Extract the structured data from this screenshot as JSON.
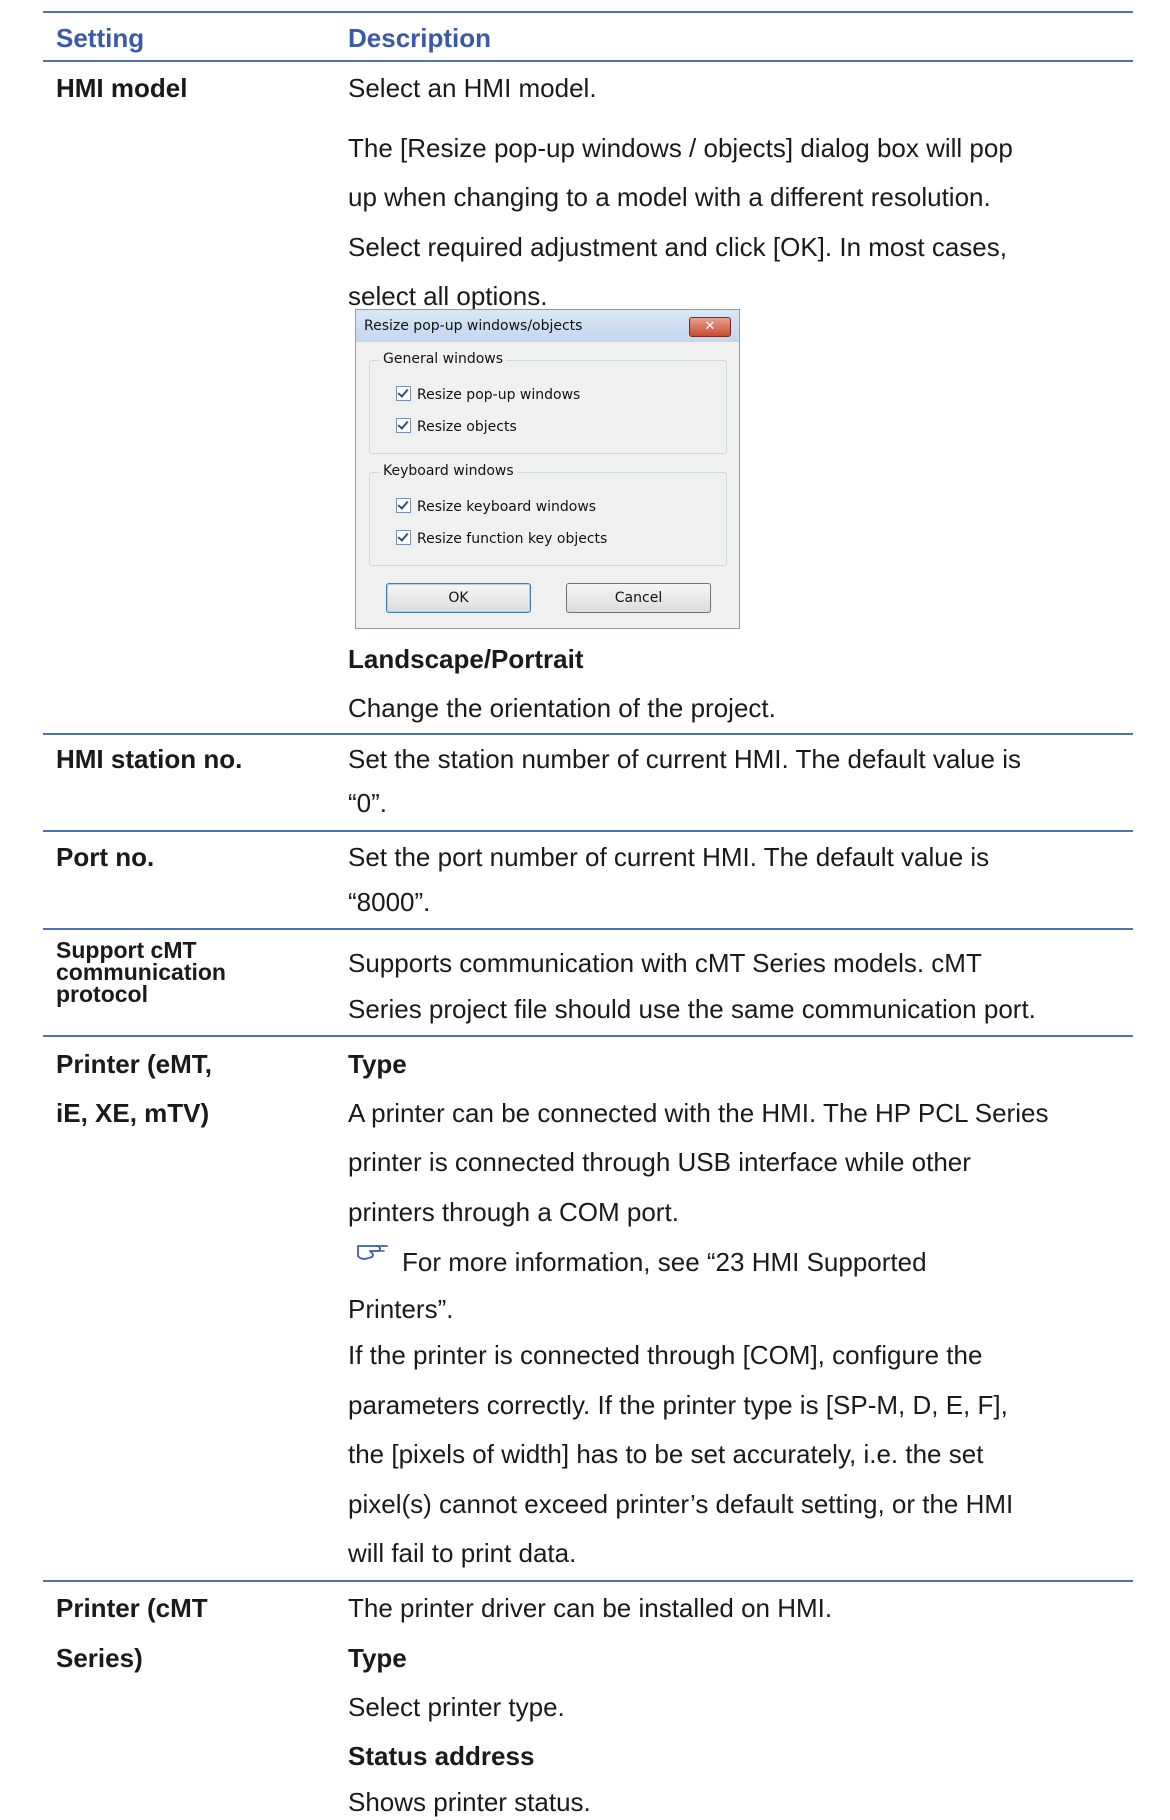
{
  "header": {
    "setting": "Setting",
    "description": "Description"
  },
  "rows": {
    "hmi_model": {
      "setting": "HMI model",
      "lines": [
        "Select an HMI model.",
        "The [Resize pop-up windows / objects] dialog box will pop",
        "up when changing to a model with a different resolution.",
        "Select required adjustment and click [OK]. In most cases,",
        "select all options."
      ],
      "sub_heading": "Landscape/Portrait",
      "sub_text": "Change the orientation of the project."
    },
    "station": {
      "setting": "HMI station no.",
      "lines": [
        "Set the station number of current HMI. The default value is",
        "“0”."
      ]
    },
    "port": {
      "setting": "Port no.",
      "lines": [
        "Set the port number of current HMI. The default value is",
        "“8000”."
      ]
    },
    "cmt_protocol": {
      "setting_lines": [
        "Support cMT",
        "communication",
        "protocol"
      ],
      "lines": [
        "Supports communication with cMT Series models. cMT",
        "Series project file should use the same communication port."
      ]
    },
    "printer_emt": {
      "setting_lines": [
        "Printer (eMT,",
        "iE, XE, mTV)"
      ],
      "type_heading": "Type",
      "lines_a": [
        "A printer can be connected with the HMI. The HP PCL Series",
        "printer is connected through USB interface while other",
        "printers through a COM port."
      ],
      "note_lines": [
        "For more information, see “23 HMI Supported",
        "Printers”."
      ],
      "lines_b": [
        "If the printer is connected through [COM], configure the",
        "parameters correctly. If the printer type is [SP-M, D, E, F],",
        "the [pixels of width] has to be set accurately, i.e. the set",
        "pixel(s) cannot exceed printer’s default setting, or the HMI",
        "will fail to print data."
      ]
    },
    "printer_cmt": {
      "setting_lines": [
        "Printer (cMT",
        "Series)"
      ],
      "line1": "The printer driver can be installed on HMI.",
      "type_heading": "Type",
      "type_text": "Select printer type.",
      "status_heading": "Status address",
      "status_text": "Shows printer status."
    }
  },
  "dialog": {
    "title": "Resize pop-up windows/objects",
    "close_glyph": "✕",
    "group1": {
      "label": "General windows",
      "options": [
        "Resize pop-up windows",
        "Resize objects"
      ]
    },
    "group2": {
      "label": "Keyboard windows",
      "options": [
        "Resize keyboard windows",
        "Resize function key objects"
      ]
    },
    "ok_label": "OK",
    "cancel_label": "Cancel"
  },
  "icons": {
    "note": "pointing-hand-icon"
  },
  "colors": {
    "heading_blue": "#3c58a8",
    "rule_blue": "#4f72b4"
  }
}
